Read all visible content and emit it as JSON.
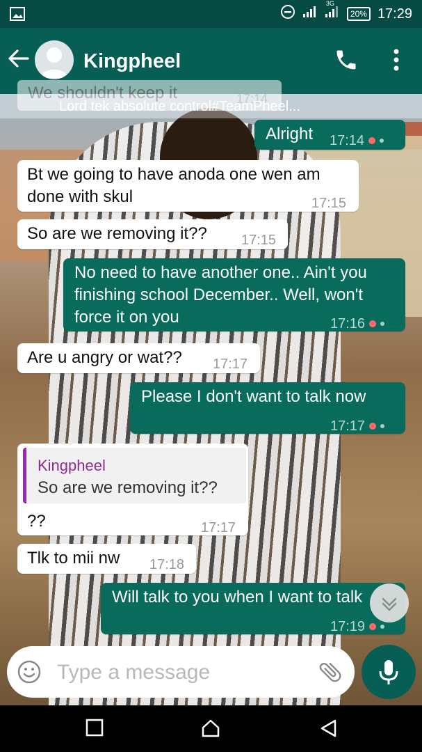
{
  "status_bar": {
    "network_label": "3G",
    "battery": "20%",
    "time": "17:29",
    "icons": [
      "image-icon",
      "dnd-icon",
      "signal-icon",
      "signal-3g-icon",
      "battery-icon"
    ]
  },
  "header": {
    "contact_name": "Kingpheel",
    "icons": [
      "back-arrow-icon",
      "avatar-icon",
      "phone-icon",
      "more-vert-icon"
    ]
  },
  "pinned": {
    "text": "Lord tek absolute control#TeamPheel...",
    "cut_message": "We shouldn't keep it",
    "cut_time": "17:14"
  },
  "messages": [
    {
      "dir": "out",
      "text": "Alright",
      "time": "17:14"
    },
    {
      "dir": "in",
      "text": "Bt we going to have anoda one wen am done with skul",
      "time": "17:15"
    },
    {
      "dir": "in",
      "text": "So are we removing it??",
      "time": "17:15"
    },
    {
      "dir": "out",
      "text": "No need to have another one.. Ain't you finishing school December.. Well, won't force it on you",
      "time": "17:16"
    },
    {
      "dir": "in",
      "text": "Are u angry or wat??",
      "time": "17:17"
    },
    {
      "dir": "out",
      "text": "Please I don't want to talk now",
      "time": "17:17"
    },
    {
      "dir": "in",
      "quote_name": "Kingpheel",
      "quote_text": "So are we removing it??",
      "text": "??",
      "time": "17:17"
    },
    {
      "dir": "in",
      "text": "Tlk to mii nw",
      "time": "17:18"
    },
    {
      "dir": "out",
      "text": "Will talk to you when I want to talk",
      "time": "17:19"
    }
  ],
  "composer": {
    "placeholder": "Type a message",
    "icons": [
      "emoji-icon",
      "attach-icon",
      "mic-icon"
    ]
  },
  "nav": {
    "icons": [
      "recents-icon",
      "home-icon",
      "back-icon"
    ]
  },
  "colors": {
    "header": "#075e54",
    "status_bar": "#054b43",
    "outgoing_bubble": "#086b5b",
    "incoming_bubble": "#ffffff",
    "quote_bar": "#9c27b0"
  }
}
